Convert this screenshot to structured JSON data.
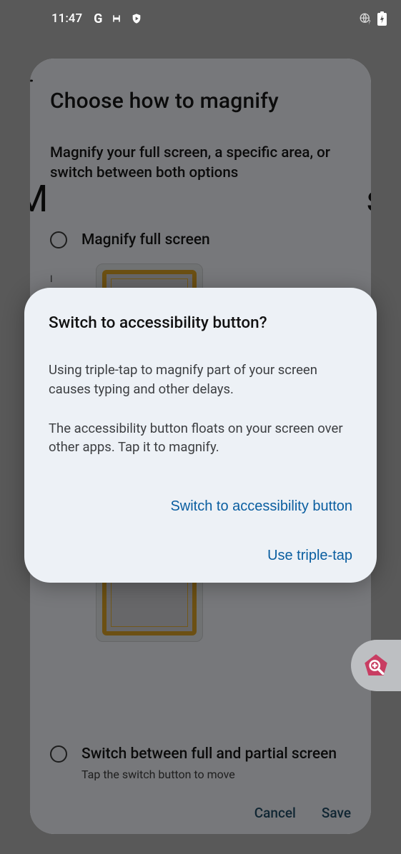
{
  "statusbar": {
    "time": "11:47",
    "icons_left": [
      "G",
      "sync",
      "shield"
    ],
    "icons_right": [
      "globe-question",
      "battery-charging"
    ]
  },
  "bg": {
    "title": "Choose how to magnify",
    "subtitle": "Magnify your full screen, a specific area, or switch between both options",
    "hidden_letter_left": "M",
    "hidden_letter_right": "s",
    "section_hint_1": "I",
    "section_hint_2": "s",
    "option1": "Magnify full screen",
    "option2": "Switch between full and partial screen",
    "option2_sub": "Tap the switch button to move",
    "cancel": "Cancel",
    "save": "Save"
  },
  "dialog": {
    "title": "Switch to accessibility button?",
    "p1": "Using triple-tap to magnify part of your screen causes typing and other delays.",
    "p2": "The accessibility button floats on your screen over other apps. Tap it to magnify.",
    "primary": "Switch to accessibility button",
    "secondary": "Use triple-tap"
  },
  "fab": {
    "name": "magnify"
  }
}
